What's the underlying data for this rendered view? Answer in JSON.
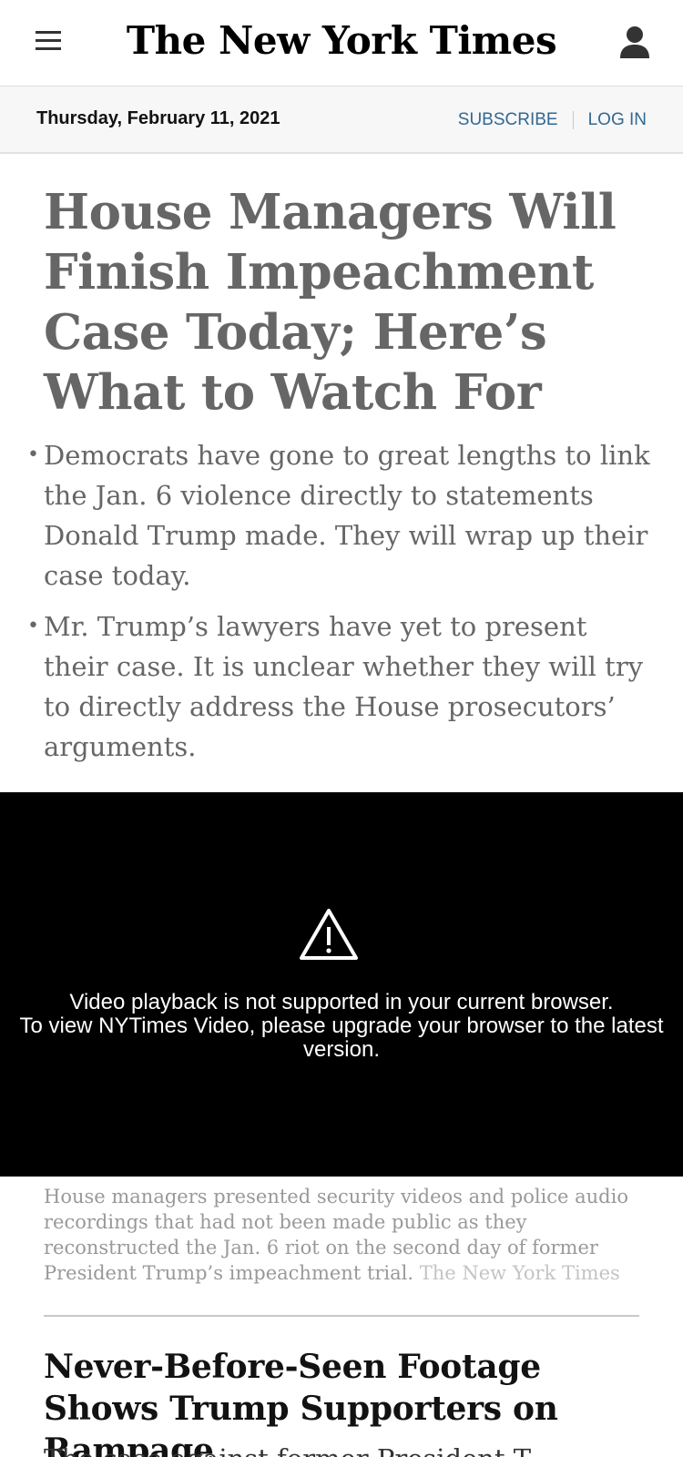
{
  "header": {
    "logo": "The New York Times",
    "menu_icon": "hamburger-menu-icon",
    "account_icon": "user-account-icon"
  },
  "datebar": {
    "date": "Thursday, February 11, 2021",
    "subscribe": "SUBSCRIBE",
    "login": "LOG IN"
  },
  "article": {
    "headline": "House Managers Will Finish Impeachment Case Today; Here’s What to Watch For",
    "summary": [
      "Democrats have gone to great lengths to link the Jan. 6 violence directly to statements Donald Trump made. They will wrap up their case today.",
      "Mr. Trump’s lawyers have yet to present their case. It is unclear whether they will try to directly address the House prosecutors’ arguments."
    ]
  },
  "video": {
    "icon": "warning-icon",
    "message_line1": "Video playback is not supported in your current browser.",
    "message_line2": "To view NYTimes Video, please upgrade your browser to the latest version."
  },
  "caption": {
    "text": "House managers presented security videos and police audio recordings that had not been made public as they reconstructed the Jan. 6 riot on the second day of former President Trump’s impeachment trial.",
    "credit": "The New York Times"
  },
  "second_story": {
    "headline": "Never-Before-Seen Footage Shows Trump Supporters on Rampage",
    "summary_partial": "The case against former President T"
  },
  "colors": {
    "link": "#326891",
    "headline_gray": "#666666",
    "video_bg": "#000000"
  }
}
